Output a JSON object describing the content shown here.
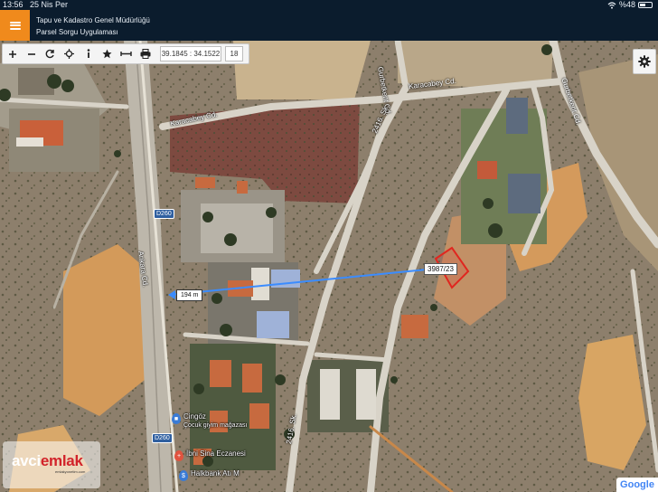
{
  "status_bar": {
    "time": "13:56",
    "date": "25 Nis Per",
    "battery": "%48",
    "battery_level": 0.48
  },
  "header": {
    "menu_icon": "hamburger-icon",
    "title": "Tapu ve Kadastro Genel Müdürlüğü",
    "subtitle": "Parsel Sorgu Uygulaması"
  },
  "toolbar": {
    "tools": [
      {
        "name": "zoom-in",
        "icon": "plus-icon"
      },
      {
        "name": "zoom-out",
        "icon": "minus-icon"
      },
      {
        "name": "refresh",
        "icon": "refresh-icon"
      },
      {
        "name": "locate",
        "icon": "crosshair-icon"
      },
      {
        "name": "info",
        "icon": "info-icon"
      },
      {
        "name": "favorite",
        "icon": "star-icon"
      },
      {
        "name": "measure",
        "icon": "ruler-icon"
      },
      {
        "name": "print",
        "icon": "printer-icon"
      }
    ],
    "coordinates": "39.1845 : 34.1522",
    "zoom_level": "18"
  },
  "settings": {
    "icon": "gear-icon"
  },
  "map": {
    "road_labels": {
      "karacabey_top": "Karacabey Cd.",
      "karacabey_left": "Karacabey Cd.",
      "gurbet_left": "Gurbetkent Cd.",
      "gurbet_right": "Gurbetkent Cd.",
      "sk_2416_top": "2416. Sk.",
      "sk_2416_bottom": "2416. Sk.",
      "ankara": "Ankara Cd."
    },
    "shields": {
      "d260_top": "D260",
      "d260_bottom": "D260"
    },
    "parcel_label": "3987/23",
    "distance_label": "194 m",
    "pois": [
      {
        "name": "Cingöz",
        "sub": "Çocuk giyim mağazası",
        "color": "#3a7bd5",
        "icon": "shopping-bag-icon"
      },
      {
        "name": "İbni Sina Eczanesi",
        "sub": "",
        "color": "#e0533f",
        "icon": "pharmacy-icon"
      },
      {
        "name": "Halkbank Atı M",
        "sub": "",
        "color": "#3a7bd5",
        "icon": "bank-icon"
      }
    ],
    "watermark": {
      "prefix": "avci",
      "brand": "emlak",
      "sub": "emlakyonetim.com"
    },
    "attribution": "Google"
  }
}
